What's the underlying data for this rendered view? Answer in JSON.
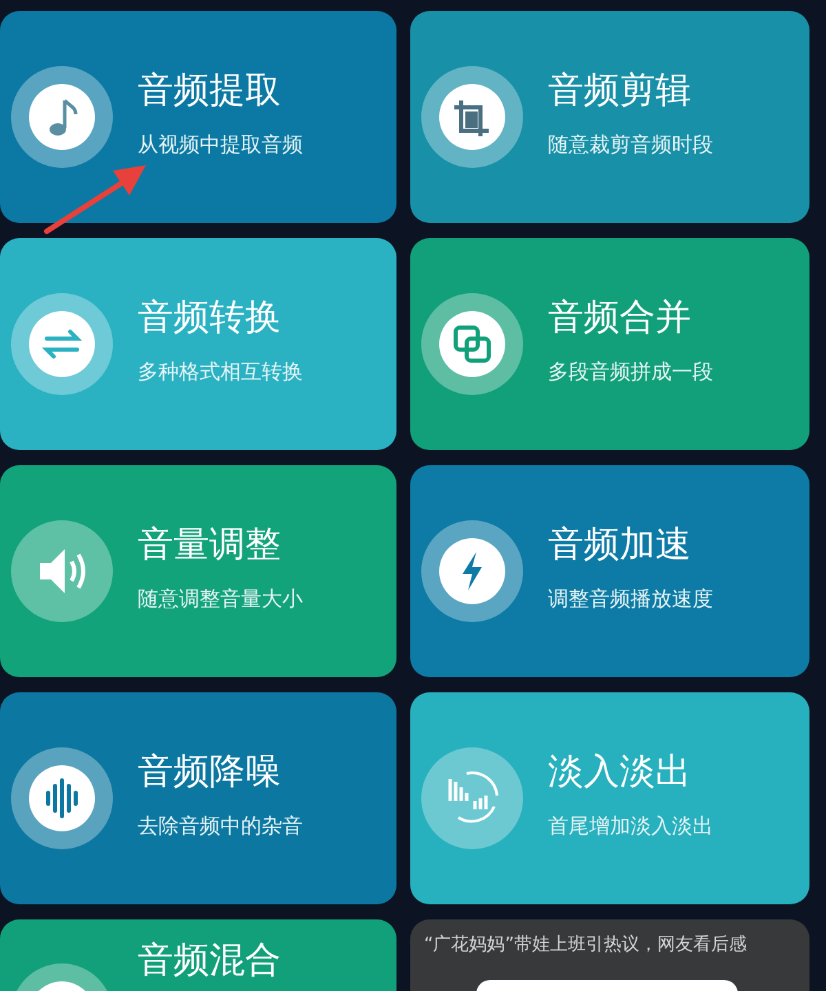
{
  "tools": [
    {
      "kind": "note",
      "title": "音频提取",
      "subtitle": "从视频中提取音频",
      "color": "#0b79a4"
    },
    {
      "kind": "crop",
      "title": "音频剪辑",
      "subtitle": "随意裁剪音频时段",
      "color": "#1890a8"
    },
    {
      "kind": "convert",
      "title": "音频转换",
      "subtitle": "多种格式相互转换",
      "color": "#2ab2c3"
    },
    {
      "kind": "merge",
      "title": "音频合并",
      "subtitle": "多段音频拼成一段",
      "color": "#12a07a"
    },
    {
      "kind": "volume",
      "title": "音量调整",
      "subtitle": "随意调整音量大小",
      "color": "#13a37b"
    },
    {
      "kind": "speed",
      "title": "音频加速",
      "subtitle": "调整音频播放速度",
      "color": "#0d7ba5"
    },
    {
      "kind": "denoise",
      "title": "音频降噪",
      "subtitle": "去除音频中的杂音",
      "color": "#0c78a1"
    },
    {
      "kind": "fade",
      "title": "淡入淡出",
      "subtitle": "首尾增加淡入淡出",
      "color": "#27b0bd"
    },
    {
      "kind": "mix",
      "title": "音频混合",
      "color": "#12a07a"
    }
  ],
  "popup": {
    "text": "“广花妈妈”带娃上班引热议，网友看后感"
  }
}
